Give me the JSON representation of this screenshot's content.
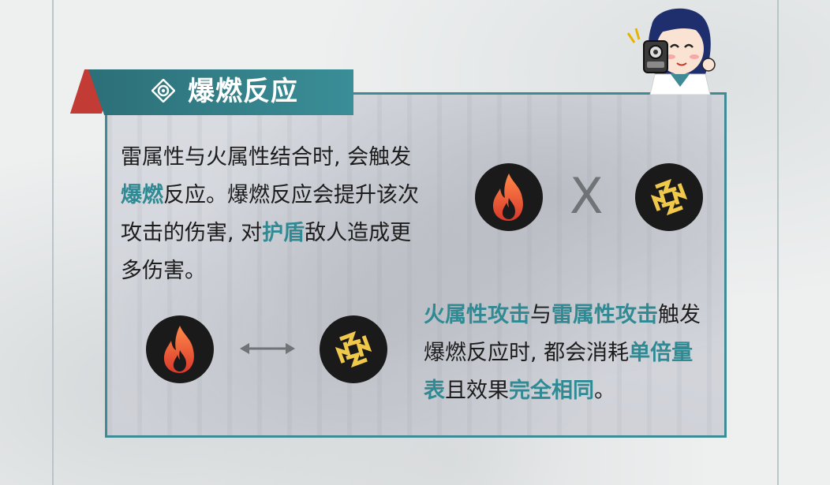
{
  "banner": {
    "title": "爆燃反应"
  },
  "para1": {
    "line1": "雷属性与火属性结合时, 会触发",
    "hl1": "爆燃",
    "line2a": "反应。爆燃反应会提升该次",
    "line3a": "攻击的伤害, 对",
    "hl2": "护盾",
    "line3b": "敌人造成更",
    "line4": "多伤害。"
  },
  "para2": {
    "hl1": "火属性攻击",
    "t1": "与",
    "hl2": "雷属性攻击",
    "t2": "触发",
    "t3": "爆燃反应时, 都会消耗",
    "hl3": "单倍量",
    "hl4": "表",
    "t4": "且效果",
    "hl5": "完全相同",
    "t5": "。"
  },
  "symbols": {
    "x_sign": "X"
  },
  "icons": {
    "banner": "target-diamond-icon",
    "fire": "fire-element-icon",
    "electric": "electric-element-icon",
    "swap": "double-arrow-icon",
    "mascot": "mascot-character-icon"
  },
  "colors": {
    "accent": "#3f8a94",
    "highlight": "#2f8a93",
    "banner_red": "#c23b34",
    "fire": "#e8553a",
    "electric": "#f0c84a"
  }
}
